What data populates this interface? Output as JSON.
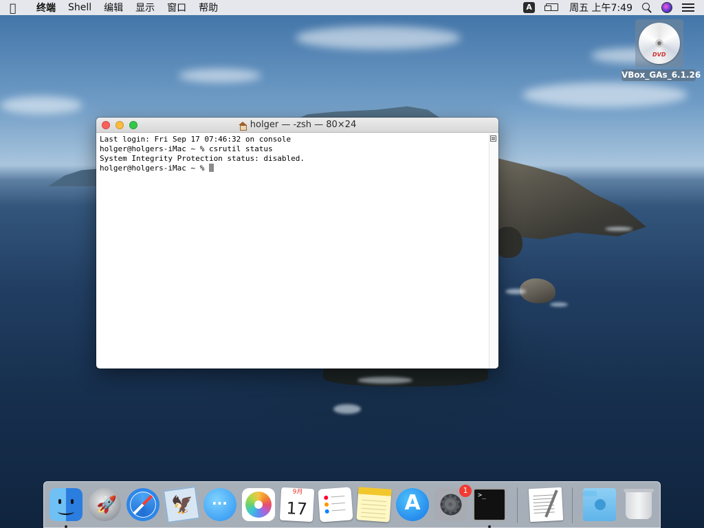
{
  "menubar": {
    "apple_icon": "apple-logo",
    "app_name": "终端",
    "items": [
      "Shell",
      "编辑",
      "显示",
      "窗口",
      "帮助"
    ],
    "input_source": "A",
    "clock": "周五 上午7:49"
  },
  "desktop": {
    "dvd_label": "VBox_GAs_6.1.26",
    "dvd_logo": "DVD"
  },
  "terminal": {
    "title": "holger — -zsh — 80×24",
    "lines": [
      "Last login: Fri Sep 17 07:46:32 on console",
      "holger@holgers-iMac ~ % csrutil status",
      "System Integrity Protection status: disabled.",
      "holger@holgers-iMac ~ % "
    ]
  },
  "dock": {
    "calendar_month": "9月",
    "calendar_day": "17",
    "sysprefs_badge": "1",
    "terminal_prompt": ">_",
    "apps": [
      "finder",
      "launchpad",
      "safari",
      "preview",
      "messages",
      "photos",
      "calendar",
      "reminders",
      "notes",
      "app-store",
      "system-preferences",
      "terminal",
      "textedit",
      "downloads",
      "trash"
    ]
  },
  "colors": {
    "close": "#fc605b",
    "minimize": "#fdbc40",
    "maximize": "#34c84a",
    "badge": "#f23a33"
  }
}
